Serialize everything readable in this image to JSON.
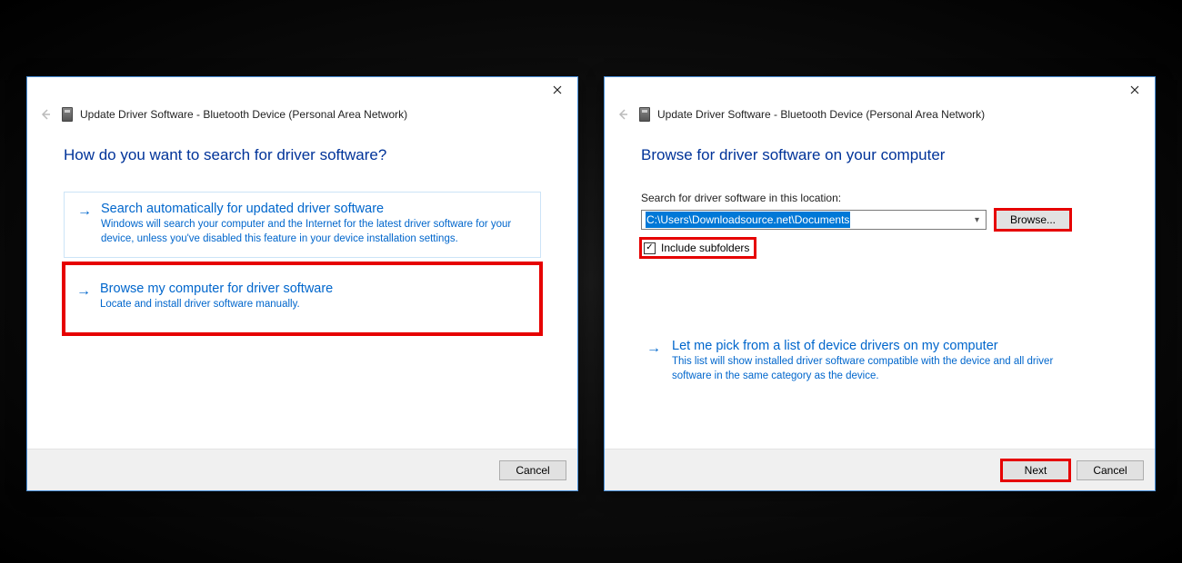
{
  "colors": {
    "link": "#0066cc",
    "accent": "#003399",
    "highlight": "#e60000"
  },
  "left": {
    "window_title": "Update Driver Software - Bluetooth Device (Personal Area Network)",
    "heading": "How do you want to search for driver software?",
    "options": [
      {
        "title": "Search automatically for updated driver software",
        "desc": "Windows will search your computer and the Internet for the latest driver software for your device, unless you've disabled this feature in your device installation settings."
      },
      {
        "title": "Browse my computer for driver software",
        "desc": "Locate and install driver software manually."
      }
    ],
    "cancel": "Cancel"
  },
  "right": {
    "window_title": "Update Driver Software - Bluetooth Device (Personal Area Network)",
    "heading": "Browse for driver software on your computer",
    "location_label": "Search for driver software in this location:",
    "path_value": "C:\\Users\\Downloadsource.net\\Documents",
    "browse": "Browse...",
    "include_subfolders": "Include subfolders",
    "include_subfolders_checked": true,
    "pick": {
      "title": "Let me pick from a list of device drivers on my computer",
      "desc": "This list will show installed driver software compatible with the device and all driver software in the same category as the device."
    },
    "next": "Next",
    "cancel": "Cancel"
  }
}
